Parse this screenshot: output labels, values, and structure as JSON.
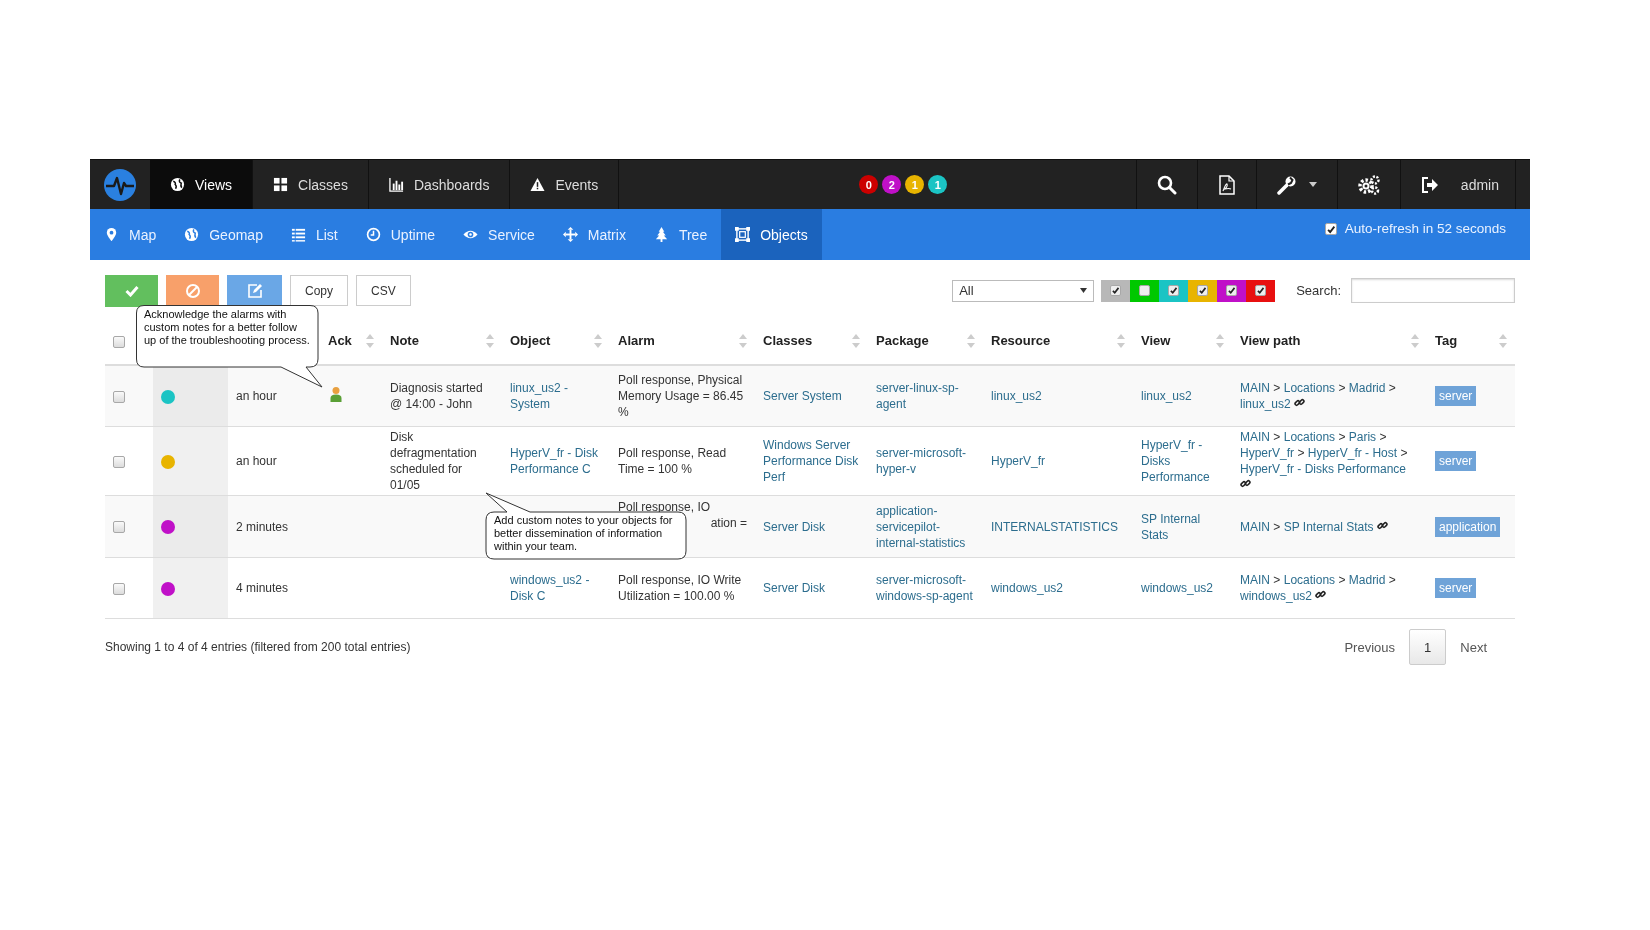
{
  "navbar": {
    "menus": [
      {
        "label": "Views",
        "selected": true
      },
      {
        "label": "Classes",
        "selected": false
      },
      {
        "label": "Dashboards",
        "selected": false
      },
      {
        "label": "Events",
        "selected": false
      }
    ],
    "badges": [
      {
        "text": "0",
        "color": "#cc0000"
      },
      {
        "text": "2",
        "color": "#c010c8"
      },
      {
        "text": "1",
        "color": "#e8b400"
      },
      {
        "text": "1",
        "color": "#1bc4c4"
      }
    ],
    "user": "admin"
  },
  "subnav": {
    "items": [
      {
        "label": "Map",
        "selected": false
      },
      {
        "label": "Geomap",
        "selected": false
      },
      {
        "label": "List",
        "selected": false
      },
      {
        "label": "Uptime",
        "selected": false
      },
      {
        "label": "Service",
        "selected": false
      },
      {
        "label": "Matrix",
        "selected": false
      },
      {
        "label": "Tree",
        "selected": false
      },
      {
        "label": "Objects",
        "selected": true
      }
    ],
    "auto_refresh": {
      "checked": true,
      "label": "Auto-refresh in 52 seconds"
    }
  },
  "toolbar": {
    "buttons": [
      {
        "kind": "acknowledge"
      },
      {
        "kind": "clear"
      },
      {
        "kind": "note"
      },
      {
        "kind": "text",
        "label": "Copy"
      },
      {
        "kind": "text",
        "label": "CSV"
      }
    ],
    "filter": {
      "value": "All"
    },
    "severity_filters": [
      {
        "color": "#b8b8b8",
        "checked": true
      },
      {
        "color": "#00c800",
        "checked": false
      },
      {
        "color": "#1bc4c4",
        "checked": true
      },
      {
        "color": "#e8b400",
        "checked": true
      },
      {
        "color": "#c010c8",
        "checked": true
      },
      {
        "color": "#e81010",
        "checked": true
      }
    ],
    "search_label": "Search:"
  },
  "table": {
    "select_all": false,
    "separator": ">",
    "columns": [
      "Ack",
      "Note",
      "Object",
      "Alarm",
      "Classes",
      "Package",
      "Resource",
      "View",
      "View path",
      "Tag"
    ],
    "rows": [
      {
        "checked": false,
        "color": "#1bc4c4",
        "time": "an hour",
        "acked": true,
        "note": "Diagnosis started @ 14:00 - John",
        "object": "linux_us2 - System",
        "alarm": "Poll response, Physical Memory Usage = 86.45 %",
        "classes": "Server System",
        "package": "server-linux-sp-agent",
        "resource": "linux_us2",
        "view": "linux_us2",
        "path": [
          "MAIN",
          "Locations",
          "Madrid",
          "linux_us2"
        ],
        "tag": "server"
      },
      {
        "checked": false,
        "color": "#e8b400",
        "time": "an hour",
        "acked": false,
        "note": "Disk defragmentation scheduled for 01/05",
        "object": "HyperV_fr - Disk Performance C",
        "alarm": "Poll response, Read Time = 100 %",
        "classes": "Windows Server Performance Disk Perf",
        "package": "server-microsoft-hyper-v",
        "resource": "HyperV_fr",
        "view": "HyperV_fr - Disks Performance",
        "path": [
          "MAIN",
          "Locations",
          "Paris",
          "HyperV_fr",
          "HyperV_fr - Host",
          "HyperV_fr - Disks Performance"
        ],
        "tag": "server"
      },
      {
        "checked": false,
        "color": "#c010c8",
        "time": "2 minutes",
        "acked": false,
        "alarm": "Poll response, IO",
        "alarm_fragment": "ation =",
        "classes": "Server Disk",
        "package": "application-servicepilot-internal-statistics",
        "resource": "INTERNALSTATISTICS",
        "view": "SP Internal Stats",
        "path": [
          "MAIN",
          "SP Internal Stats"
        ],
        "tag": "application"
      },
      {
        "checked": false,
        "color": "#c010c8",
        "time": "4 minutes",
        "acked": false,
        "object": "windows_us2 - Disk C",
        "alarm": "Poll response, IO Write Utilization = 100.00 %",
        "classes": "Server Disk",
        "package": "server-microsoft-windows-sp-agent",
        "resource": "windows_us2",
        "view": "windows_us2",
        "path": [
          "MAIN",
          "Locations",
          "Madrid",
          "windows_us2"
        ],
        "tag": "server"
      }
    ]
  },
  "callouts": [
    "Acknowledge the alarms with custom notes for a better follow up of the troubleshooting process.",
    "Add custom notes to your objects for better dissemination of information within your team."
  ],
  "footer": {
    "info": "Showing 1 to 4 of 4 entries (filtered from 200 total entries)",
    "pagination": [
      {
        "label": "Previous",
        "selected": false
      },
      {
        "label": "1",
        "selected": true
      },
      {
        "label": "Next",
        "selected": false
      }
    ]
  }
}
